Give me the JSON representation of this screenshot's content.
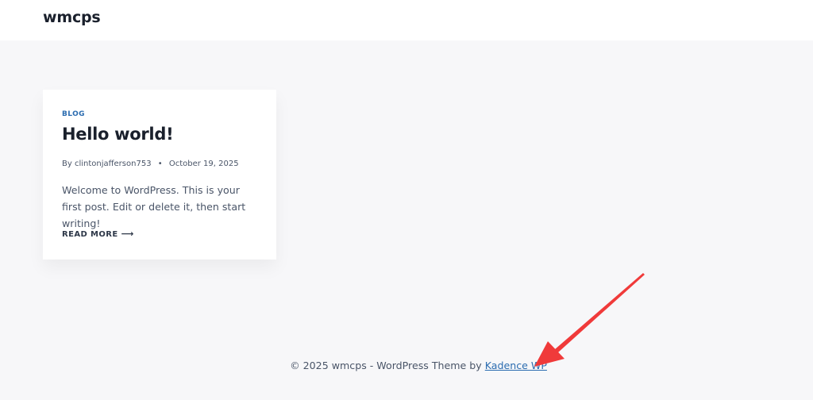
{
  "header": {
    "site_title": "wmcps"
  },
  "post": {
    "category": "BLOG",
    "title": "Hello world!",
    "meta": {
      "by": "By",
      "author": "clintonjafferson753",
      "separator": "•",
      "date": "October 19, 2025"
    },
    "excerpt": "Welcome to WordPress. This is your first post. Edit or delete it, then start writing!",
    "read_more": "READ MORE",
    "read_more_arrow": "⟶"
  },
  "footer": {
    "text": "© 2025 wmcps - WordPress Theme by",
    "link_label": "Kadence WP"
  },
  "annotation": {
    "arrow_color": "#f03a3a"
  }
}
